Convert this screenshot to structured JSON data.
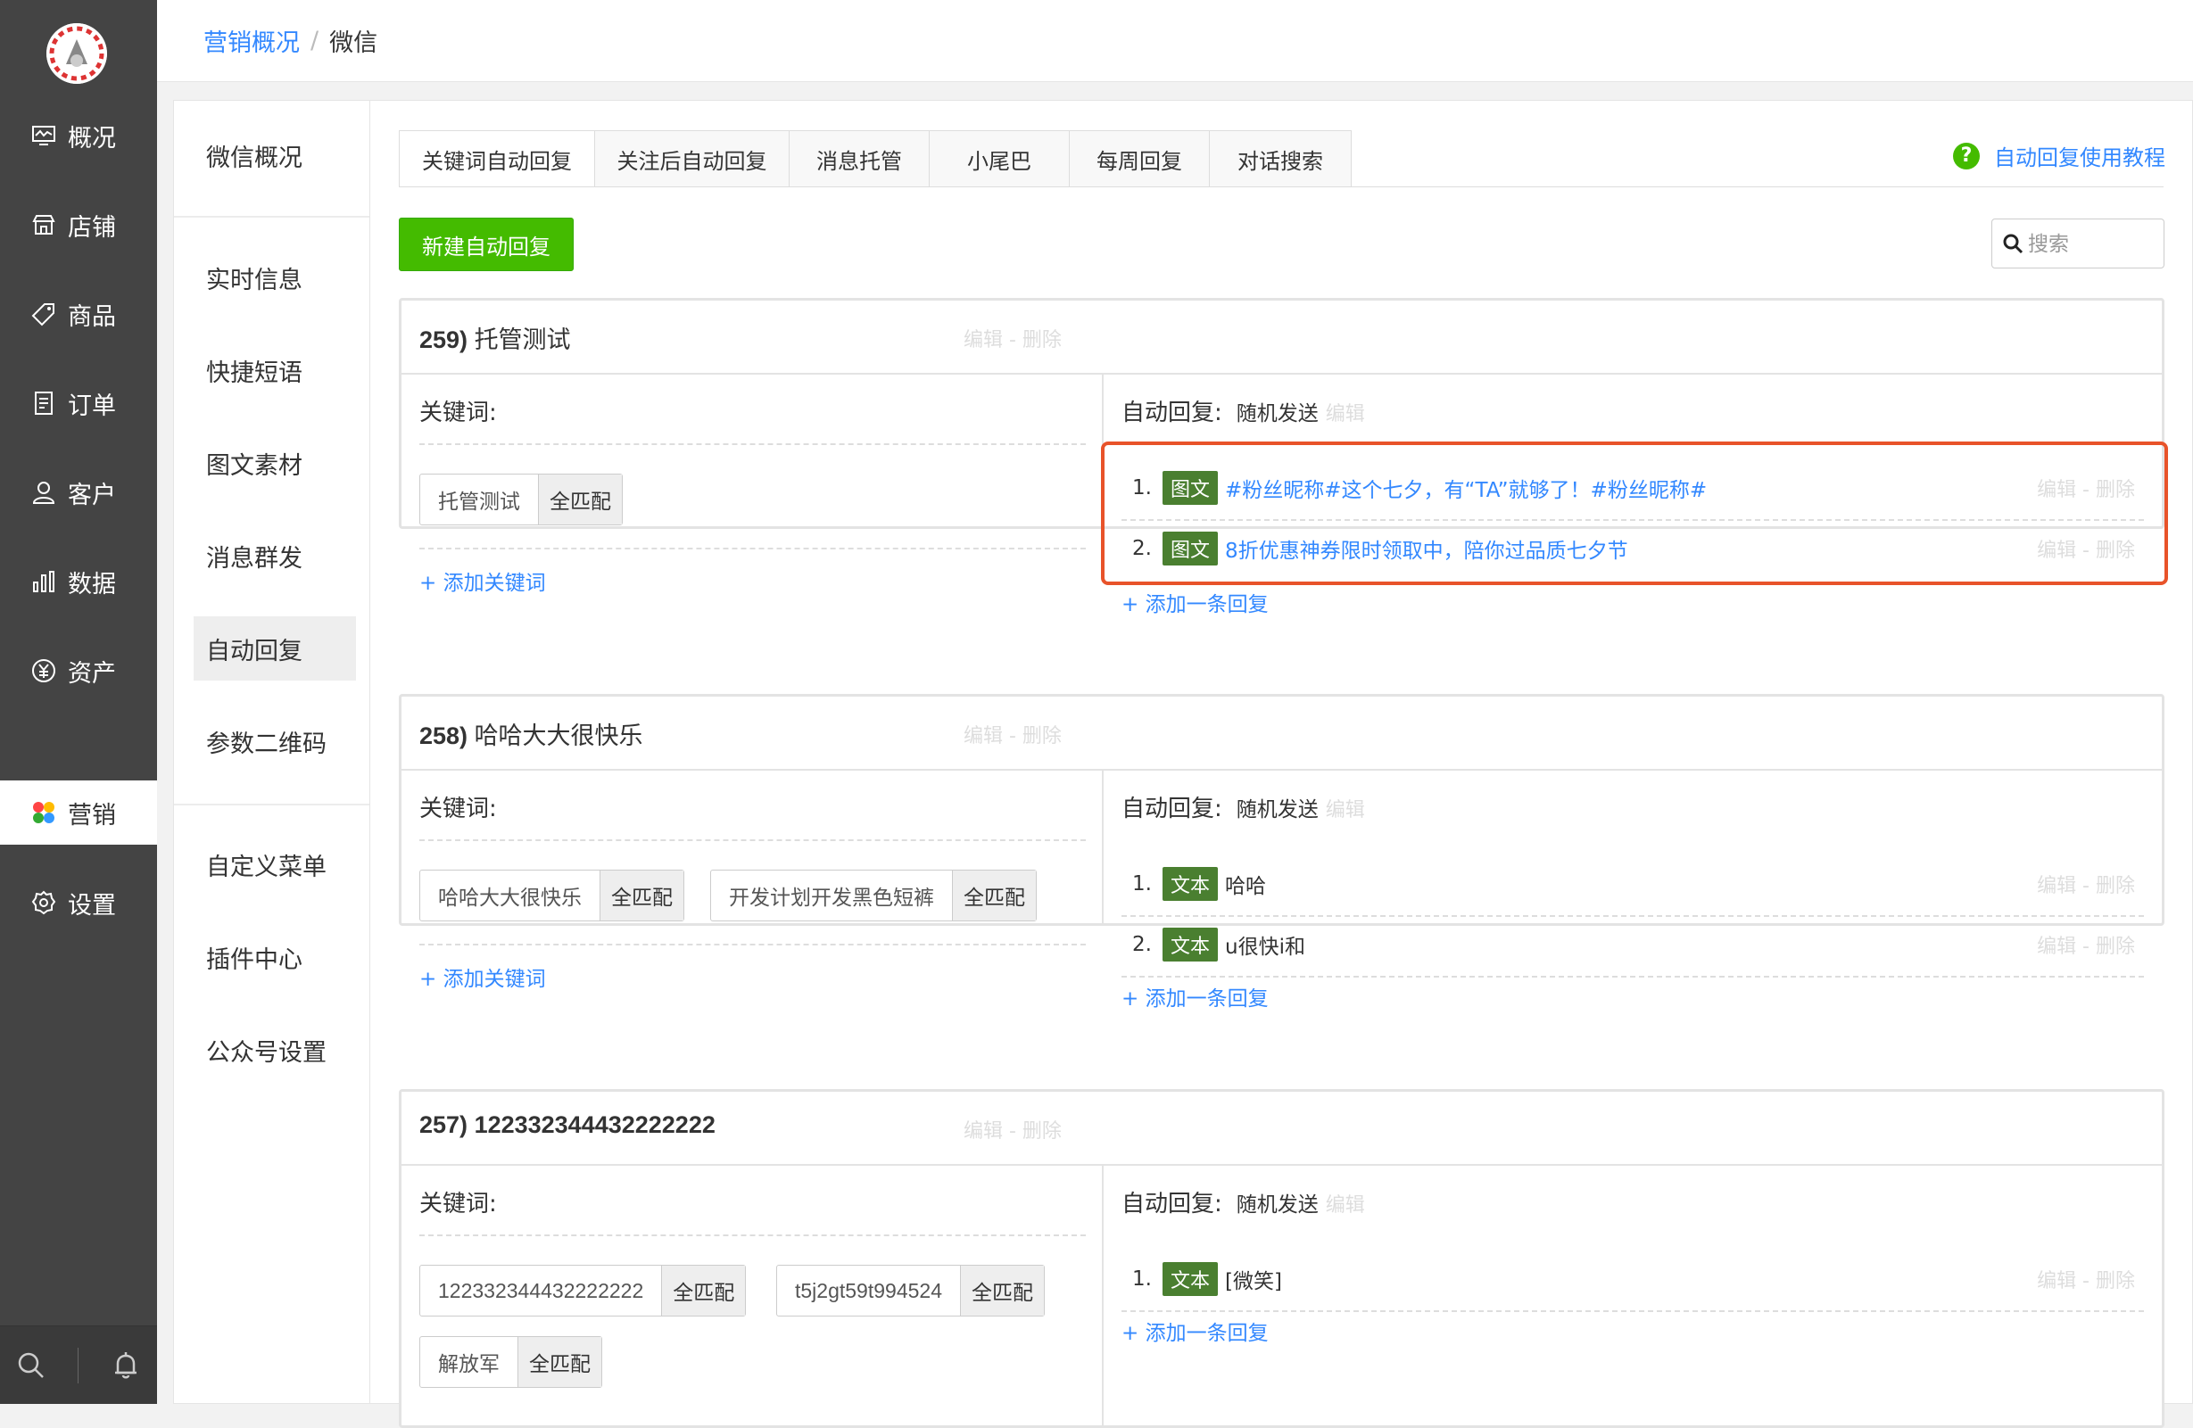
{
  "colors": {
    "accent_blue": "#3388ff",
    "green": "#44bb00",
    "badge_green": "#4a7f30",
    "nav_bg": "#444444",
    "highlight": "#e8532a"
  },
  "nav": {
    "items": [
      {
        "label": "概况",
        "icon": "monitor-icon"
      },
      {
        "label": "店铺",
        "icon": "store-icon"
      },
      {
        "label": "商品",
        "icon": "tag-icon"
      },
      {
        "label": "订单",
        "icon": "order-icon"
      },
      {
        "label": "客户",
        "icon": "user-icon"
      },
      {
        "label": "数据",
        "icon": "bar-chart-icon"
      },
      {
        "label": "资产",
        "icon": "yen-icon"
      },
      {
        "label": "营销",
        "icon": "marketing-icon"
      },
      {
        "label": "设置",
        "icon": "gear-icon"
      }
    ],
    "active": "营销",
    "bottom_icons": [
      "search-icon",
      "bell-icon"
    ]
  },
  "breadcrumb": {
    "parent": "营销概况",
    "separator": "/",
    "current": "微信"
  },
  "subnav": {
    "items": [
      "微信概况",
      "实时信息",
      "快捷短语",
      "图文素材",
      "消息群发",
      "自动回复",
      "参数二维码",
      "自定义菜单",
      "插件中心",
      "公众号设置"
    ],
    "active": "自动回复"
  },
  "tabs": [
    "关键词自动回复",
    "关注后自动回复",
    "消息托管",
    "小尾巴",
    "每周回复",
    "对话搜索"
  ],
  "active_tab": "关键词自动回复",
  "help_link": "自动回复使用教程",
  "new_button": "新建自动回复",
  "search": {
    "placeholder": "搜索",
    "value": ""
  },
  "labels": {
    "keywords": "关键词:",
    "auto_reply": "自动回复:",
    "add_keyword": "+ 添加关键词",
    "add_reply": "+ 添加一条回复",
    "ops": "编辑 - 删除",
    "edit": "编辑"
  },
  "rules": [
    {
      "id": "259)",
      "name": "托管测试",
      "reply_mode": "随机发送",
      "keywords": [
        {
          "text": "托管测试",
          "match": "全匹配"
        }
      ],
      "replies": [
        {
          "num": "1.",
          "type": "图文",
          "text": "#粉丝昵称#这个七夕，有“TA”就够了！#粉丝昵称#"
        },
        {
          "num": "2.",
          "type": "图文",
          "text": "8折优惠神券限时领取中，陪你过品质七夕节"
        }
      ]
    },
    {
      "id": "258)",
      "name": "哈哈大大很快乐",
      "reply_mode": "随机发送",
      "keywords": [
        {
          "text": "哈哈大大很快乐",
          "match": "全匹配"
        },
        {
          "text": "开发计划开发黑色短裤",
          "match": "全匹配"
        }
      ],
      "replies": [
        {
          "num": "1.",
          "type": "文本",
          "text": "哈哈"
        },
        {
          "num": "2.",
          "type": "文本",
          "text": "u很快i和"
        }
      ]
    },
    {
      "id": "257)",
      "name": "122332344432222222",
      "reply_mode": "随机发送",
      "keywords": [
        {
          "text": "122332344432222222",
          "match": "全匹配"
        },
        {
          "text": "t5j2gt59t994524",
          "match": "全匹配"
        },
        {
          "text": "解放军",
          "match": "全匹配"
        }
      ],
      "replies": [
        {
          "num": "1.",
          "type": "文本",
          "text": "[微笑]"
        }
      ]
    }
  ]
}
